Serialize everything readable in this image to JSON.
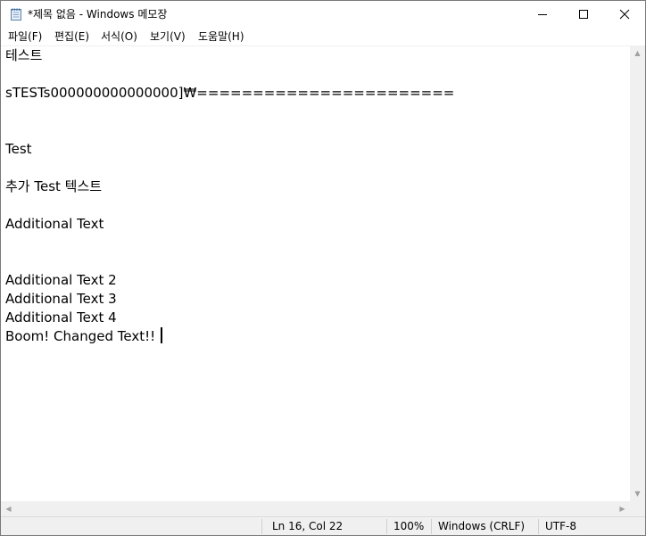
{
  "window": {
    "title": "*제목 없음 - Windows 메모장",
    "icons": {
      "app": "notepad-icon",
      "minimize": "minimize-icon",
      "maximize": "maximize-icon",
      "close": "close-icon"
    }
  },
  "menu": [
    {
      "label": "파일(F)"
    },
    {
      "label": "편집(E)"
    },
    {
      "label": "서식(O)"
    },
    {
      "label": "보기(V)"
    },
    {
      "label": "도움말(H)"
    }
  ],
  "editor": {
    "lines": [
      "테스트",
      "",
      "sTESTs000000000000000]₩=======================",
      "",
      "",
      "Test",
      "",
      "추가 Test 텍스트",
      "",
      "Additional Text",
      "",
      "",
      "Additional Text 2",
      "Additional Text 3",
      "Additional Text 4",
      "Boom! Changed Text!!"
    ]
  },
  "status": {
    "position": "Ln 16, Col 22",
    "zoom": "100%",
    "line_ending": "Windows (CRLF)",
    "encoding": "UTF-8"
  }
}
